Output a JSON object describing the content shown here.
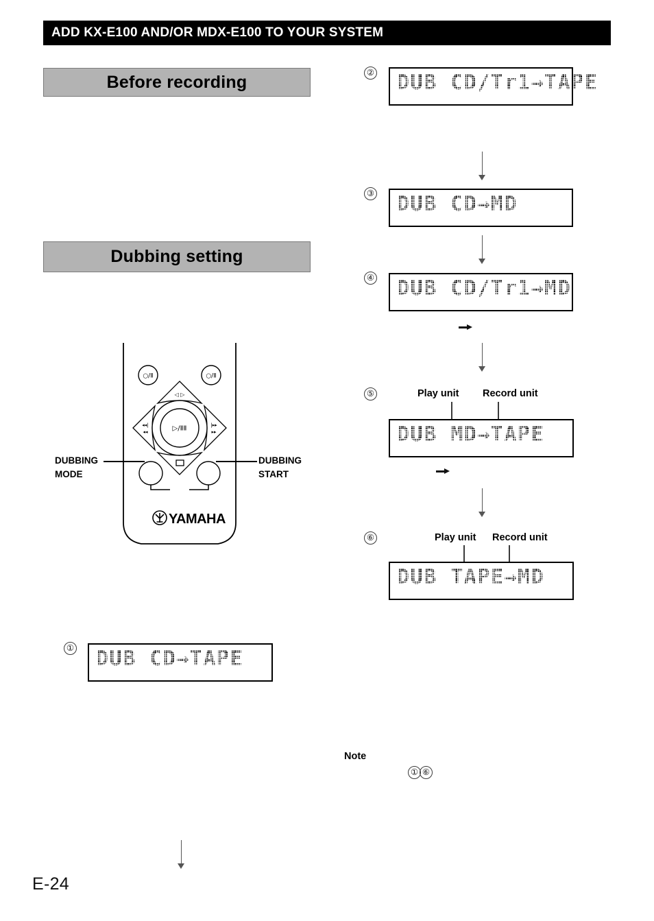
{
  "header": {
    "title": "ADD KX-E100 AND/OR MDX-E100 TO YOUR SYSTEM"
  },
  "sections": [
    {
      "id": "before-recording",
      "label": "Before recording"
    },
    {
      "id": "dubbing-setting",
      "label": "Dubbing setting"
    }
  ],
  "remote": {
    "brand": "YAMAHA",
    "callouts": {
      "left_line1": "DUBBING",
      "left_line2": "MODE",
      "right_line1": "DUBBING",
      "right_line2": "START"
    },
    "buttons": {
      "power_left": "○/Ⅱ",
      "power_right": "○/Ⅱ",
      "up": "◁ ▷",
      "left": "◂◂ / ◂◂",
      "right": "▸▸ / ▸▸",
      "center": "▷/ⅡⅡ",
      "down": "□"
    }
  },
  "displays": [
    {
      "step": "①",
      "text": "DUB CD→TAPE",
      "play_unit": null,
      "record_unit": null
    },
    {
      "step": "②",
      "text": "DUB CD/Tr1→TAPE",
      "play_unit": null,
      "record_unit": null
    },
    {
      "step": "③",
      "text": "DUB CD→MD",
      "play_unit": null,
      "record_unit": null
    },
    {
      "step": "④",
      "text": "DUB CD/Tr1→MD",
      "play_unit": null,
      "record_unit": null
    },
    {
      "step": "⑤",
      "text": "DUB MD→TAPE",
      "play_unit": "Play unit",
      "record_unit": "Record unit"
    },
    {
      "step": "⑥",
      "text": "DUB TAPE→MD",
      "play_unit": "Play unit",
      "record_unit": "Record unit"
    }
  ],
  "note": {
    "label": "Note",
    "refs": [
      "①",
      "⑥"
    ]
  },
  "footer": {
    "page_number": "E-24"
  },
  "colors": {
    "header_band": "#000000",
    "header_text": "#ffffff",
    "section_bar": "#b3b3b3",
    "section_border": "#7a7a7a",
    "lcd_border": "#000000",
    "arrow": "#555555"
  }
}
